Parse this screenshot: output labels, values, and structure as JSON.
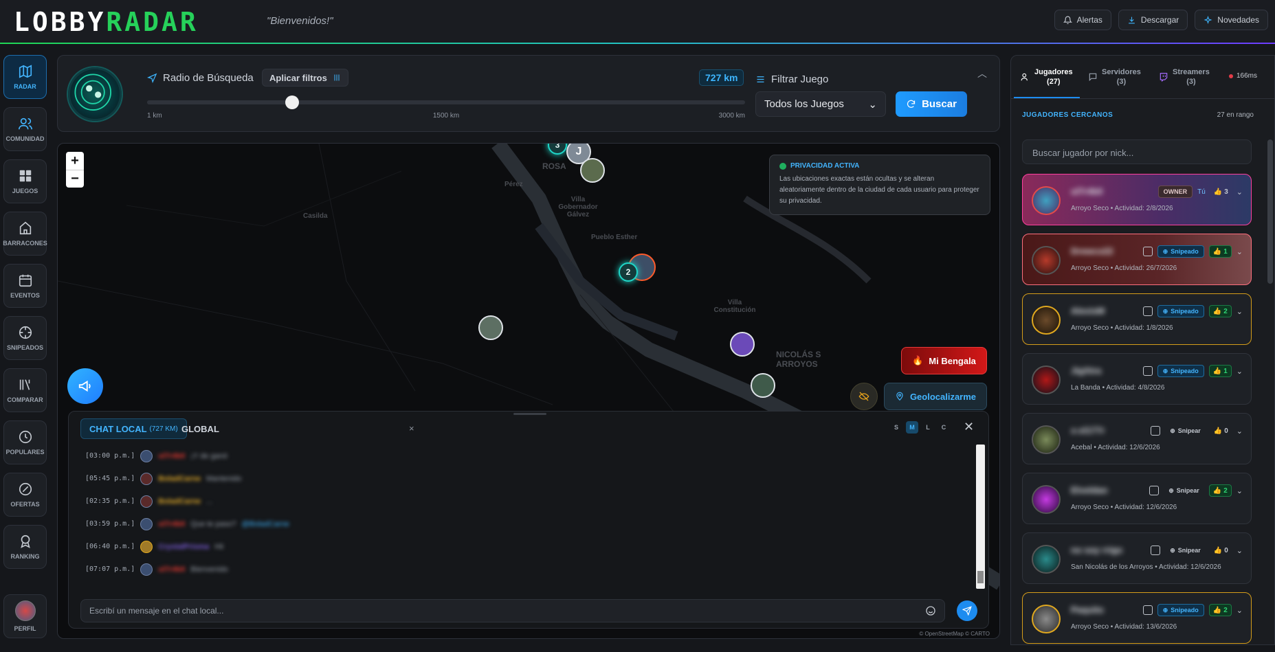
{
  "app": {
    "logo_part1": "LOBBY",
    "logo_part2": "RADAR",
    "welcome": "\"Bienvenidos!\""
  },
  "topbar": {
    "buttons": [
      {
        "label": "Alertas",
        "icon": "bell-icon"
      },
      {
        "label": "Descargar",
        "icon": "download-icon"
      },
      {
        "label": "Novedades",
        "icon": "sparkle-icon"
      }
    ]
  },
  "sidebar": {
    "items": [
      {
        "label": "RADAR",
        "icon": "map-icon",
        "active": true
      },
      {
        "label": "COMUNIDAD",
        "icon": "users-icon"
      },
      {
        "label": "JUEGOS",
        "icon": "grid-icon"
      },
      {
        "label": "BARRACONES",
        "icon": "castle-icon"
      },
      {
        "label": "EVENTOS",
        "icon": "calendar-icon"
      },
      {
        "label": "SNIPEADOS",
        "icon": "crosshair-icon"
      },
      {
        "label": "COMPARAR",
        "icon": "compare-icon"
      },
      {
        "label": "POPULARES",
        "icon": "clock-icon"
      },
      {
        "label": "OFERTAS",
        "icon": "tag-icon"
      },
      {
        "label": "RANKING",
        "icon": "medal-icon"
      }
    ],
    "profile_label": "PERFIL"
  },
  "search_panel": {
    "radius_title": "Radio de Búsqueda",
    "apply_filters": "Aplicar filtros",
    "km_value": "727 km",
    "slider": {
      "min_label": "1 km",
      "mid_label": "1500 km",
      "max_label": "3000 km",
      "value_km": 727,
      "max_km": 3000
    },
    "filter_title": "Filtrar Juego",
    "game_select": "Todos los Juegos",
    "search_button": "Buscar"
  },
  "map": {
    "privacy_title": "PRIVACIDAD ACTIVA",
    "privacy_text": "Las ubicaciones exactas están ocultas y se alteran aleatoriamente dentro de la ciudad de cada usuario para proteger su privacidad.",
    "labels": [
      "Pérez",
      "ROSA",
      "Casilda",
      "Villa Gobernador Gálvez",
      "Pueblo Esther",
      "Villa Constitución",
      "NICOLÁS S ARROYOS"
    ],
    "clusters": [
      "3",
      "2"
    ],
    "marker_letter": "J",
    "bengala_button": "Mi Bengala",
    "geo_button": "Geolocalizarme",
    "attribution": "© OpenStreetMap © CARTO"
  },
  "chat": {
    "tab_local": "CHAT LOCAL",
    "tab_local_sub": "(727 KM)",
    "tab_global": "GLOBAL",
    "sizes": [
      "S",
      "M",
      "L",
      "C"
    ],
    "active_size": "M",
    "messages": [
      {
        "time": "[03:00 p.m.]",
        "nick": "ul7r4b0",
        "text": "¡Y de ganó",
        "color": "#e2372f"
      },
      {
        "time": "[05:45 p.m.]",
        "nick": "BoladCarne",
        "text": "Mantenido",
        "color": "#e1a928"
      },
      {
        "time": "[02:35 p.m.]",
        "nick": "BoladCarne",
        "text": "...",
        "color": "#e1a928"
      },
      {
        "time": "[03:59 p.m.]",
        "nick": "ul7r4b0",
        "text": "Que te paso?",
        "color": "#e2372f",
        "extra": "@BoladCarne"
      },
      {
        "time": "[06:40 p.m.]",
        "nick": "CrystalPrisma",
        "text": "Hii",
        "color": "#7a5bd6"
      },
      {
        "time": "[07:07 p.m.]",
        "nick": "ul7r4b0",
        "text": "Bienvenido",
        "color": "#e2372f"
      }
    ],
    "input_placeholder": "Escribí un mensaje en el chat local..."
  },
  "right_panel": {
    "tabs": [
      {
        "label": "Jugadores",
        "count": "(27)",
        "icon": "users-icon",
        "active": true
      },
      {
        "label": "Servidores",
        "count": "(3)",
        "icon": "chat-icon"
      },
      {
        "label": "Streamers",
        "count": "(3)",
        "icon": "twitch-icon"
      }
    ],
    "latency": "166ms",
    "nearby_caption": "JUGADORES CERCANOS",
    "in_range": "27 en rango",
    "search_placeholder": "Buscar jugador por nick...",
    "players": [
      {
        "name": "ul7r4b0",
        "location": "Arroyo Seco",
        "activity": "Actividad: 2/8/2026",
        "badge": "OWNER",
        "tu": "Tú",
        "snipe": "",
        "likes": "3",
        "style": "owner"
      },
      {
        "name": "Drewco22",
        "location": "Arroyo Seco",
        "activity": "Actividad: 26/7/2026",
        "snipe": "Snipeado",
        "likes": "1",
        "style": "snip1"
      },
      {
        "name": "AlexisM",
        "location": "Arroyo Seco",
        "activity": "Actividad: 1/8/2026",
        "snipe": "Snipeado",
        "likes": "2",
        "style": "gold"
      },
      {
        "name": "JigXtra",
        "location": "La Banda",
        "activity": "Actividad: 4/8/2026",
        "snipe": "Snipeado",
        "likes": "1",
        "style": ""
      },
      {
        "name": "x-xl177r",
        "location": "Acebal",
        "activity": "Actividad: 12/6/2026",
        "snipe": "Snipear",
        "likes": "0",
        "style": ""
      },
      {
        "name": "Elveldan",
        "location": "Arroyo Seco",
        "activity": "Actividad: 12/6/2026",
        "snipe": "Snipear",
        "likes": "2",
        "style": ""
      },
      {
        "name": "no soy rrigo",
        "location": "San Nicolás de los Arroyos",
        "activity": "Actividad: 12/6/2026",
        "snipe": "Snipear",
        "likes": "0",
        "style": ""
      },
      {
        "name": "Paquito",
        "location": "Arroyo Seco",
        "activity": "Actividad: 13/6/2026",
        "snipe": "Snipeado",
        "likes": "2",
        "style": "gold"
      }
    ]
  }
}
